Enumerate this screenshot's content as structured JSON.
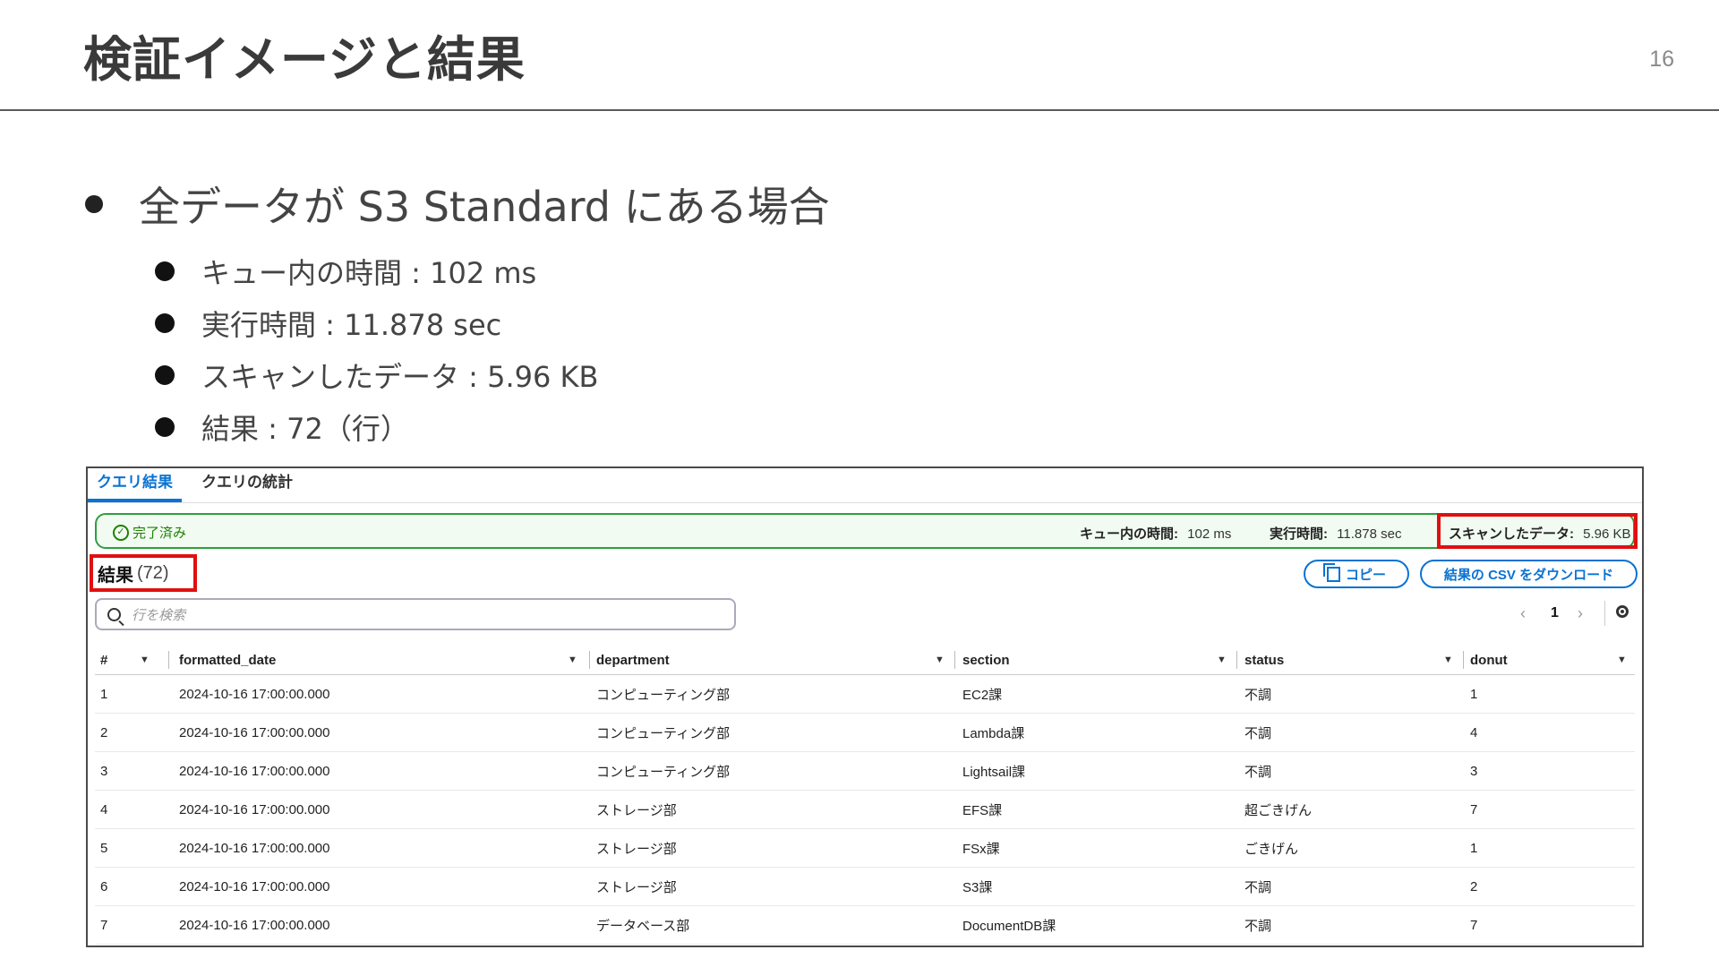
{
  "slide": {
    "title": "検証イメージと結果",
    "page_number": "16"
  },
  "bullets": {
    "main": "全データが S3 Standard にある場合",
    "items": [
      "キュー内の時間 : 102 ms",
      "実行時間 : 11.878 sec",
      "スキャンしたデータ : 5.96 KB",
      "結果 : 72（行）"
    ]
  },
  "console": {
    "tabs": [
      "クエリ結果",
      "クエリの統計"
    ],
    "status": {
      "text": "完了済み",
      "queue_label": "キュー内の時間:",
      "queue_value": "102 ms",
      "exec_label": "実行時間:",
      "exec_value": "11.878 sec",
      "scan_label": "スキャンしたデータ:",
      "scan_value": "5.96 KB"
    },
    "results_label": "結果",
    "results_count": "(72)",
    "copy_label": "コピー",
    "download_label": "結果の CSV をダウンロード",
    "search_placeholder": "行を検索",
    "pager": {
      "prev": "‹",
      "page": "1",
      "next": "›"
    },
    "columns": [
      "#",
      "formatted_date",
      "department",
      "section",
      "status",
      "donut"
    ],
    "rows": [
      [
        "1",
        "2024-10-16 17:00:00.000",
        "コンピューティング部",
        "EC2課",
        "不調",
        "1"
      ],
      [
        "2",
        "2024-10-16 17:00:00.000",
        "コンピューティング部",
        "Lambda課",
        "不調",
        "4"
      ],
      [
        "3",
        "2024-10-16 17:00:00.000",
        "コンピューティング部",
        "Lightsail課",
        "不調",
        "3"
      ],
      [
        "4",
        "2024-10-16 17:00:00.000",
        "ストレージ部",
        "EFS課",
        "超ごきげん",
        "7"
      ],
      [
        "5",
        "2024-10-16 17:00:00.000",
        "ストレージ部",
        "FSx課",
        "ごきげん",
        "1"
      ],
      [
        "6",
        "2024-10-16 17:00:00.000",
        "ストレージ部",
        "S3課",
        "不調",
        "2"
      ],
      [
        "7",
        "2024-10-16 17:00:00.000",
        "データベース部",
        "DocumentDB課",
        "不調",
        "7"
      ]
    ]
  }
}
